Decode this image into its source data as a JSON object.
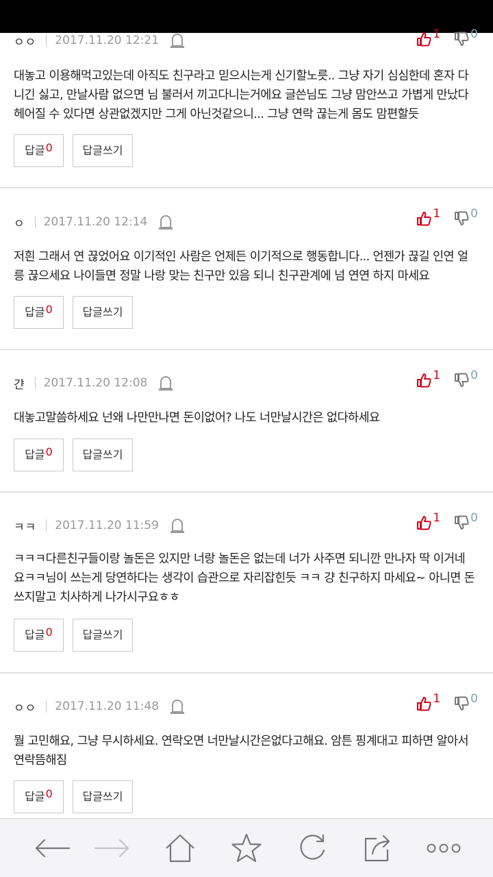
{
  "comments": [
    {
      "author": "ㅇㅇ",
      "date": "2017.11.20 12:21",
      "up": "1",
      "down": "0",
      "lines": [
        "대놓고 이용해먹고있는데 아직도 친구라고 믿으시는게 신기할노릇.. 그냥 자기 심심한데 혼자 다",
        "니긴 싫고, 만날사람 없으면 님 불러서 끼고다니는거에요 글쓴님도 그냥 맘안쓰고 가볍게 만났다",
        "헤어질 수 있다면 상관없겠지만 그게 아닌것같으니... 그냥 연락 끊는게 몸도 맘편할듯"
      ],
      "reply_label": "답글",
      "reply_count": "0",
      "write_label": "답글쓰기"
    },
    {
      "author": "ㅇ",
      "date": "2017.11.20 12:14",
      "up": "1",
      "down": "0",
      "lines": [
        "저흰 그래서 연 끊었어요 이기적인 사람은 언제든 이기적으로 행동합니다... 언젠가 끊길 인연 얼",
        "릉 끊으세요 나이들면 정말 나랑 맞는 친구만 있음 되니 친구관계에 넘 연연 하지 마세요"
      ],
      "reply_label": "답글",
      "reply_count": "0",
      "write_label": "답글쓰기"
    },
    {
      "author": "갼",
      "date": "2017.11.20 12:08",
      "up": "1",
      "down": "0",
      "lines": [
        "대놓고말씀하세요 넌왜 나만만나면 돈이없어? 나도 너만날시간은 없다하세요"
      ],
      "reply_label": "답글",
      "reply_count": "0",
      "write_label": "답글쓰기"
    },
    {
      "author": "ㅋㅋ",
      "date": "2017.11.20 11:59",
      "up": "1",
      "down": "0",
      "lines": [
        "ㅋㅋㅋ다른친구들이랑 놀돈은 있지만 너랑 놀돈은 없는데 너가 사주면 되니깐 만나자 딱 이거네",
        "요ㅋㅋ님이 쓰는게 당연하다는 생각이 습관으로 자리잡힌듯 ㅋㅋ 걍 친구하지 마세요~ 아니면 돈",
        "쓰지말고 치사하게 나가시구요ㅎㅎ"
      ],
      "reply_label": "답글",
      "reply_count": "0",
      "write_label": "답글쓰기"
    },
    {
      "author": "ㅇㅇ",
      "date": "2017.11.20 11:48",
      "up": "1",
      "down": "0",
      "lines": [
        "뭘 고민해요, 그냥 무시하세요. 연락오면 너만날시간은없다고해요. 암튼 핑계대고 피하면 알아서",
        "연락뜸해짐"
      ],
      "reply_label": "답글",
      "reply_count": "0",
      "write_label": "답글쓰기"
    }
  ],
  "nav": {
    "icons": [
      "back-icon",
      "forward-icon",
      "home-icon",
      "star-icon",
      "refresh-icon",
      "share-icon",
      "more-icon"
    ]
  },
  "colors": {
    "accent_red": "#d0021b",
    "down_count": "#7fa4b2",
    "icon_gray": "#777777"
  }
}
